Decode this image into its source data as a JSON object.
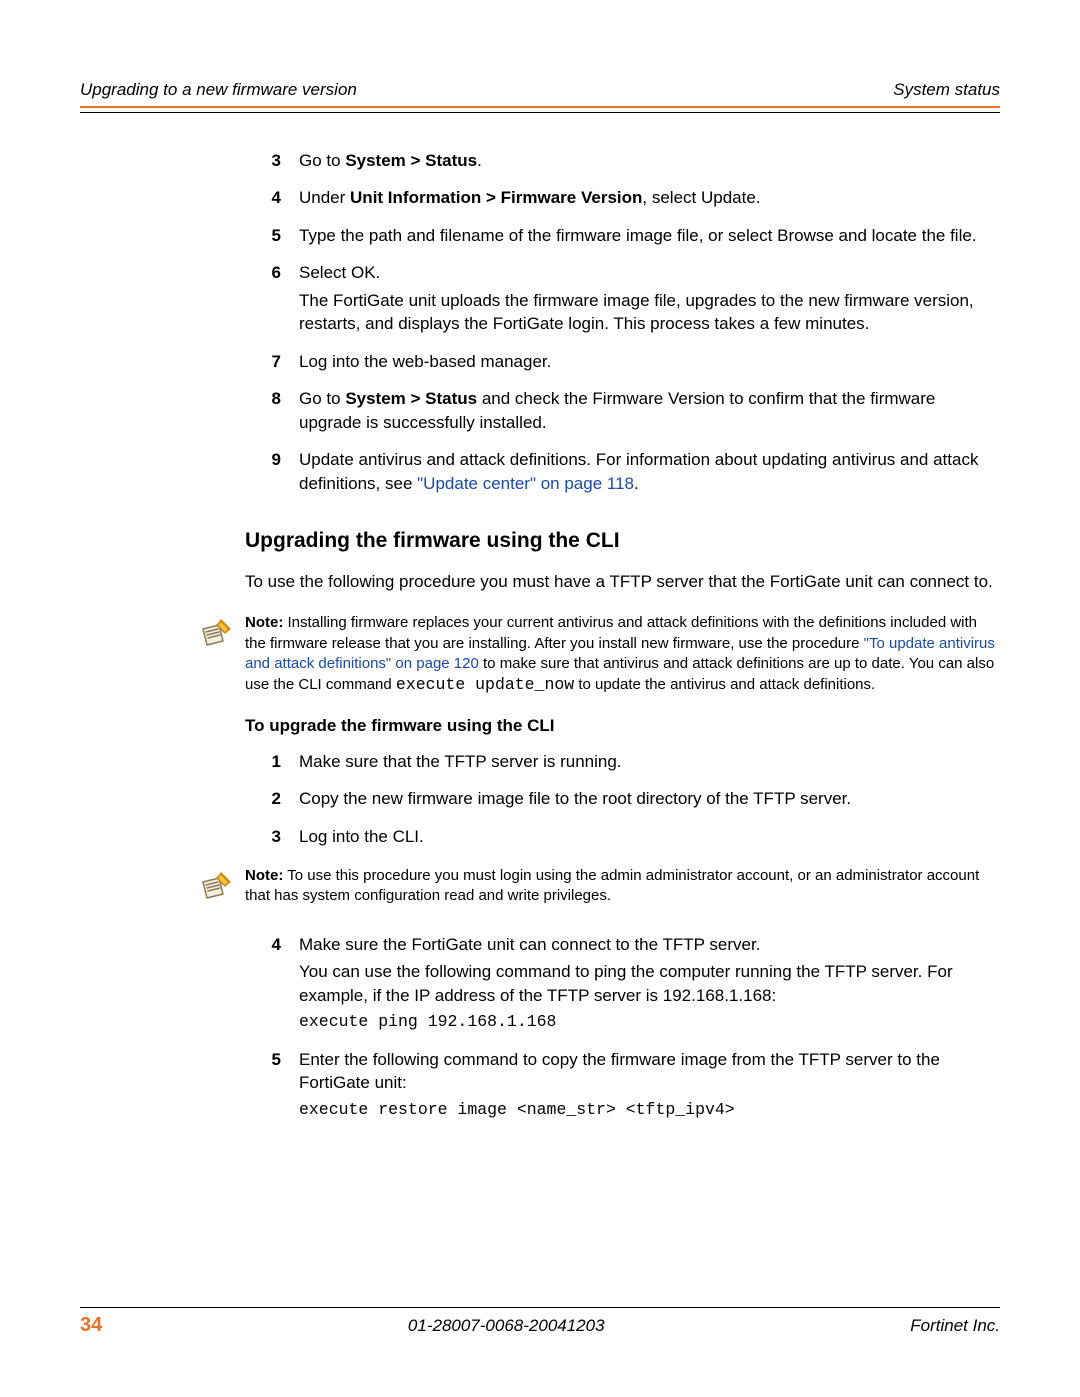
{
  "header": {
    "left": "Upgrading to a new firmware version",
    "right": "System status"
  },
  "steps_a": [
    {
      "num": "3",
      "html": "Go to <b>System > Status</b>."
    },
    {
      "num": "4",
      "html": "Under <b>Unit Information > Firmware Version</b>, select Update."
    },
    {
      "num": "5",
      "html": "Type the path and filename of the firmware image file, or select Browse and locate the file."
    },
    {
      "num": "6",
      "html": "Select OK.",
      "extra": "The FortiGate unit uploads the firmware image file, upgrades to the new firmware version, restarts, and displays the FortiGate login. This process takes a few minutes."
    },
    {
      "num": "7",
      "html": "Log into the web-based manager."
    },
    {
      "num": "8",
      "html": "Go to <b>System > Status</b> and check the Firmware Version to confirm that the firmware upgrade is successfully installed."
    },
    {
      "num": "9",
      "html": "Update antivirus and attack definitions. For information about updating antivirus and attack definitions, see <a class='link' href='#'>\"Update center\" on page 118</a>."
    }
  ],
  "section_heading": "Upgrading the firmware using the CLI",
  "section_intro": "To use the following procedure you must have a TFTP server that the FortiGate unit can connect to.",
  "note1": {
    "html": "<b>Note:</b> Installing firmware replaces your current antivirus and attack definitions with the definitions included with the firmware release that you are installing. After you install new firmware, use the procedure <a class='link' href='#'>\"To update antivirus and attack definitions\" on page 120</a> to make sure that antivirus and attack definitions are up to date. You can also use the CLI command <span class='mono'>execute update_now</span> to update the antivirus and attack definitions."
  },
  "subhead": "To upgrade the firmware using the CLI",
  "steps_b": [
    {
      "num": "1",
      "html": "Make sure that the TFTP server is running."
    },
    {
      "num": "2",
      "html": "Copy the new firmware image file to the root directory of the TFTP server."
    },
    {
      "num": "3",
      "html": "Log into the CLI."
    }
  ],
  "note2": {
    "html": "<b>Note:</b> To use this procedure you must login using the admin administrator account, or an administrator account that has system configuration read and write privileges."
  },
  "steps_c": [
    {
      "num": "4",
      "html": "Make sure the FortiGate unit can connect to the TFTP server.",
      "extra": "You can use the following command to ping the computer running the TFTP server. For example, if the IP address of the TFTP server is 192.168.1.168:",
      "code": "execute ping 192.168.1.168"
    },
    {
      "num": "5",
      "html": "Enter the following command to copy the firmware image from the TFTP server to the FortiGate unit:",
      "code": "execute restore image <name_str> <tftp_ipv4>"
    }
  ],
  "footer": {
    "page": "34",
    "center": "01-28007-0068-20041203",
    "right": "Fortinet Inc."
  }
}
